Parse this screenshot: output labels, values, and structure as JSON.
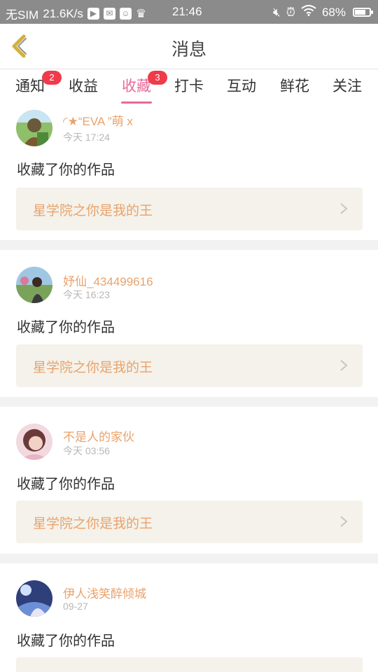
{
  "status_bar": {
    "carrier": "无SIM",
    "speed": "21.6K/s",
    "time": "21:46",
    "battery": "68%",
    "battery_level": 0.68
  },
  "header": {
    "title": "消息"
  },
  "tabs": [
    {
      "label": "通知",
      "badge": "2"
    },
    {
      "label": "收益",
      "badge": ""
    },
    {
      "label": "收藏",
      "badge": "3"
    },
    {
      "label": "打卡",
      "badge": ""
    },
    {
      "label": "互动",
      "badge": ""
    },
    {
      "label": "鲜花",
      "badge": ""
    },
    {
      "label": "关注",
      "badge": ""
    }
  ],
  "active_tab": "收藏",
  "messages": [
    {
      "user": "◜★“EVA ”萌 x",
      "time": "今天 17:24",
      "action": "收藏了你的作品",
      "work": "星学院之你是我的王"
    },
    {
      "user": "妤仙_434499616",
      "time": "今天 16:23",
      "action": "收藏了你的作品",
      "work": "星学院之你是我的王"
    },
    {
      "user": "不是人的家伙",
      "time": "今天 03:56",
      "action": "收藏了你的作品",
      "work": "星学院之你是我的王"
    },
    {
      "user": "伊人浅笑醉倾城",
      "time": "09-27",
      "action": "收藏了你的作品",
      "work": ""
    }
  ],
  "colors": {
    "accent": "#e76a9a",
    "username": "#e9a26c",
    "badge": "#ef3b4a",
    "back_arrow": "#d4b13a",
    "work_bg": "#f4f2ea"
  }
}
